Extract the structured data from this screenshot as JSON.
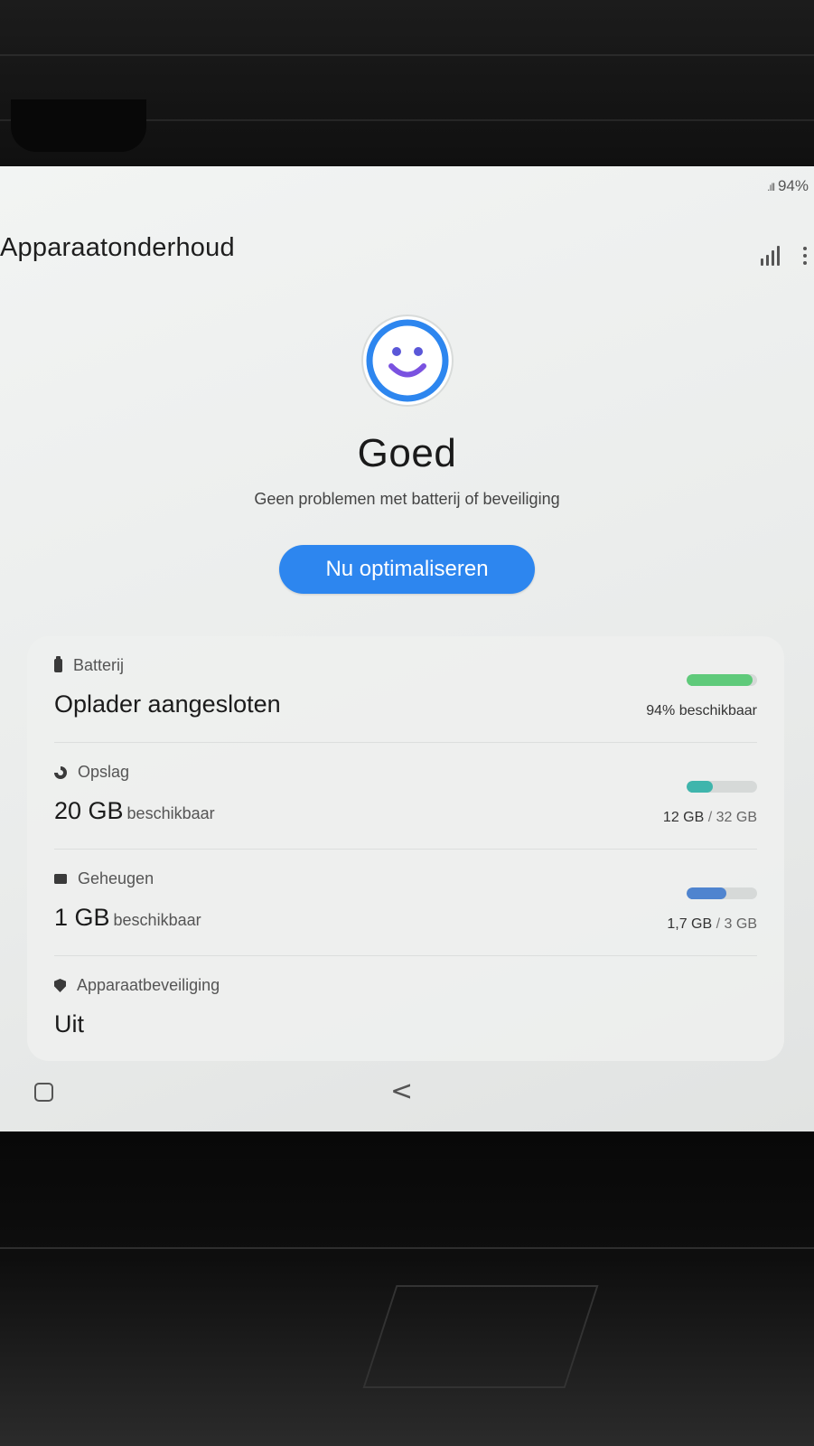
{
  "status_bar": {
    "signal": ".ıll",
    "battery_level": "94%"
  },
  "header": {
    "title": "Apparaatonderhoud",
    "stats_icon": "bar-chart-icon",
    "menu_icon": "more-options-icon"
  },
  "status": {
    "icon": "smiley-face-icon",
    "title": "Goed",
    "description": "Geen problemen met batterij of beveiliging"
  },
  "optimize_button": {
    "label": "Nu optimaliseren"
  },
  "items": {
    "battery": {
      "icon": "battery-icon",
      "label": "Batterij",
      "value": "Oplader aangesloten",
      "bar_text": "94% beschikbaar",
      "fill_fraction": 0.94,
      "bar_color": "#5fca7a"
    },
    "storage": {
      "icon": "storage-icon",
      "label": "Opslag",
      "value": "20 GB",
      "value_suffix": "beschikbaar",
      "used": "12 GB",
      "separator": "/",
      "total": "32 GB",
      "fill_fraction": 0.375,
      "bar_color": "#3fb5ac"
    },
    "memory": {
      "icon": "memory-chip-icon",
      "label": "Geheugen",
      "value": "1 GB",
      "value_suffix": "beschikbaar",
      "used": "1,7 GB",
      "separator": "/",
      "total": "3 GB",
      "fill_fraction": 0.567,
      "bar_color": "#4f84cf"
    },
    "security": {
      "icon": "shield-icon",
      "label": "Apparaatbeveiliging",
      "value": "Uit"
    }
  },
  "nav": {
    "recents_icon": "recent-apps-icon",
    "back_icon": "back-icon",
    "back_glyph": "<"
  },
  "colors": {
    "accent": "#2d86ef",
    "smiley_ring": "#2d86ef",
    "smiley_mouth": "#7a52e0"
  }
}
